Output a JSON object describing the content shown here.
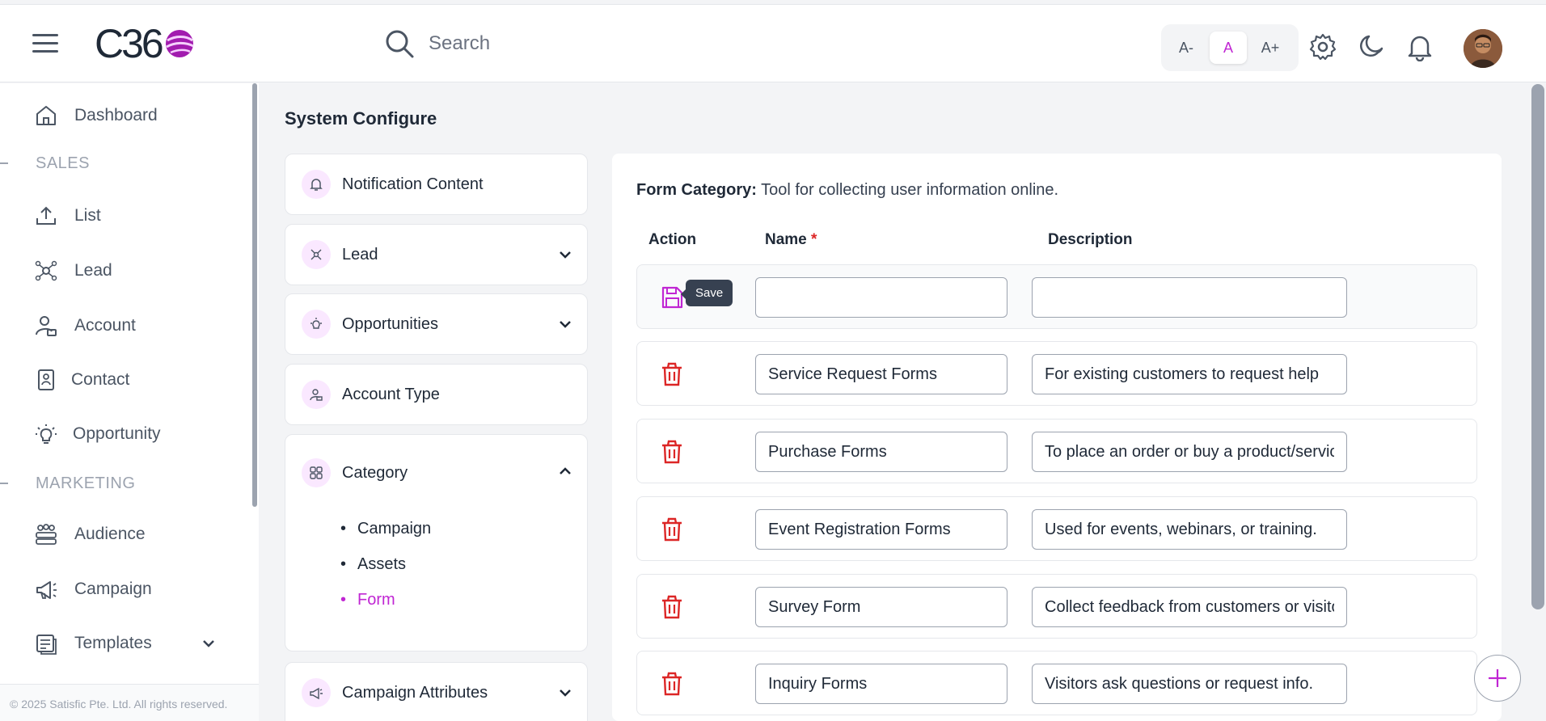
{
  "header": {
    "logo_text": "C36",
    "search_placeholder": "Search",
    "font_size": {
      "decrease": "A-",
      "normal": "A",
      "increase": "A+"
    },
    "icons": [
      "gear-icon",
      "moon-icon",
      "bell-icon"
    ]
  },
  "sidebar": {
    "dashboard": "Dashboard",
    "sales_section": "SALES",
    "list": "List",
    "lead": "Lead",
    "account": "Account",
    "contact": "Contact",
    "opportunity": "Opportunity",
    "marketing_section": "MARKETING",
    "audience": "Audience",
    "campaign": "Campaign",
    "templates": "Templates",
    "footer": "© 2025 Satisfic Pte. Ltd. All rights reserved."
  },
  "page": {
    "title": "System Configure"
  },
  "config_menu": {
    "notification": "Notification Content",
    "lead": "Lead",
    "opportunities": "Opportunities",
    "account_type": "Account Type",
    "category": "Category",
    "category_items": [
      "Campaign",
      "Assets",
      "Form"
    ],
    "campaign_attributes": "Campaign Attributes"
  },
  "form_category": {
    "label": "Form Category:",
    "description": "Tool for collecting user information online.",
    "columns": {
      "action": "Action",
      "name": "Name",
      "required_mark": "*",
      "description": "Description"
    },
    "save_tooltip": "Save",
    "rows": [
      {
        "name": "Service Request Forms",
        "description": "For existing customers to request help"
      },
      {
        "name": "Purchase Forms",
        "description": "To place an order or buy a product/service"
      },
      {
        "name": "Event Registration Forms",
        "description": "Used for events, webinars, or training."
      },
      {
        "name": "Survey Form",
        "description": "Collect feedback from customers or visitors"
      },
      {
        "name": "Inquiry Forms",
        "description": "Visitors ask questions or request info."
      }
    ]
  },
  "colors": {
    "accent": "#c026d3",
    "danger": "#dc2626",
    "icon_bg": "#fae8ff"
  }
}
